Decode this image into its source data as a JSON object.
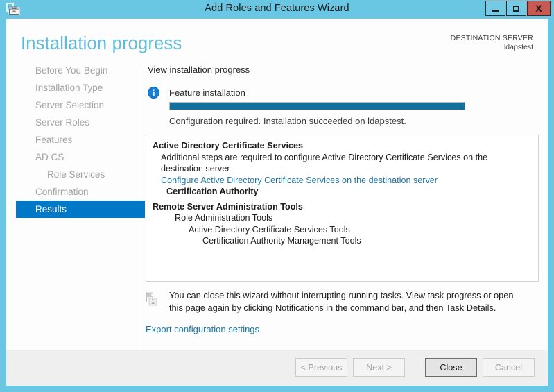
{
  "window": {
    "title": "Add Roles and Features Wizard",
    "app_icon": "server-manager-toolbox-icon",
    "minimize_label": "–",
    "maximize_label": "",
    "close_label": "X"
  },
  "header": {
    "page_title": "Installation progress",
    "destination_label": "DESTINATION SERVER",
    "destination_value": "ldapstest",
    "accent_color": "#60bbd8"
  },
  "sidebar": {
    "items": [
      {
        "label": "Before You Begin",
        "selected": false,
        "sub": false
      },
      {
        "label": "Installation Type",
        "selected": false,
        "sub": false
      },
      {
        "label": "Server Selection",
        "selected": false,
        "sub": false
      },
      {
        "label": "Server Roles",
        "selected": false,
        "sub": false
      },
      {
        "label": "Features",
        "selected": false,
        "sub": false
      },
      {
        "label": "AD CS",
        "selected": false,
        "sub": false
      },
      {
        "label": "Role Services",
        "selected": false,
        "sub": true
      },
      {
        "label": "Confirmation",
        "selected": false,
        "sub": false
      },
      {
        "label": "Results",
        "selected": true,
        "sub": false
      }
    ],
    "selected_color": "#0078c8"
  },
  "main": {
    "section_label": "View installation progress",
    "info_icon": "info-icon",
    "feature_label": "Feature installation",
    "progress": {
      "percent": 100,
      "fill_color": "#13709a",
      "status_text": "Configuration required. Installation succeeded on ldapstest."
    },
    "results": [
      {
        "text": "Active Directory Certificate Services",
        "indent": 0,
        "bold": true,
        "link": false
      },
      {
        "text": "Additional steps are required to configure Active Directory Certificate Services on the destination server",
        "indent": 1,
        "bold": false,
        "link": false
      },
      {
        "text": "Configure Active Directory Certificate Services on the destination server",
        "indent": 1,
        "bold": false,
        "link": true
      },
      {
        "text": "Certification Authority",
        "indent": 2,
        "bold": true,
        "link": false
      },
      {
        "text": "Remote Server Administration Tools",
        "indent": 0,
        "bold": true,
        "link": false
      },
      {
        "text": "Role Administration Tools",
        "indent": 3,
        "bold": false,
        "link": false
      },
      {
        "text": "Active Directory Certificate Services Tools",
        "indent": 4,
        "bold": false,
        "link": false
      },
      {
        "text": "Certification Authority Management Tools",
        "indent": 5,
        "bold": false,
        "link": false
      }
    ],
    "notice": {
      "icon": "notification-flag-icon",
      "badge": "1",
      "text": "You can close this wizard without interrupting running tasks. View task progress or open this page again by clicking Notifications in the command bar, and then Task Details."
    },
    "export_link": "Export configuration settings",
    "link_color": "#1b76a8"
  },
  "footer": {
    "buttons": [
      {
        "label": "< Previous",
        "enabled": false
      },
      {
        "label": "Next >",
        "enabled": false
      },
      {
        "label": "Close",
        "enabled": true
      },
      {
        "label": "Cancel",
        "enabled": false
      }
    ]
  }
}
